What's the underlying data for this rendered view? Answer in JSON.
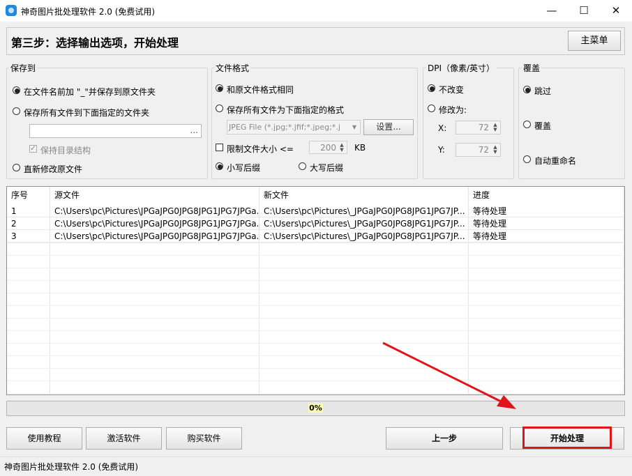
{
  "window": {
    "title": "神奇图片批处理软件 2.0 (免费试用)",
    "minimize_glyph": "—",
    "maximize_glyph": "☐",
    "close_glyph": "✕"
  },
  "header": {
    "step_title": "第三步：选择输出选项，开始处理",
    "main_menu_label": "主菜单"
  },
  "save_to": {
    "group_label": "保存到",
    "option_prefix": "在文件名前加 \"_\"并保存到原文件夹",
    "option_folder": "保存所有文件到下面指定的文件夹",
    "folder_value": "",
    "browse_label": "...",
    "keep_structure": "保持目录结构",
    "option_overwrite": "直新修改原文件"
  },
  "file_format": {
    "group_label": "文件格式",
    "same_format": "和原文件格式相同",
    "specified_format": "保存所有文件为下面指定的格式",
    "format_value": "JPEG File (*.jpg;*.jfif;*.jpeg;*.j",
    "settings_label": "设置...",
    "limit_size": "限制文件大小 <=",
    "size_value": "200",
    "size_unit": "KB",
    "lower_ext": "小写后缀",
    "upper_ext": "大写后缀"
  },
  "dpi": {
    "group_label": "DPI（像素/英寸）",
    "unchanged": "不改变",
    "modify": "修改为:",
    "x_label": "X:",
    "x_value": "72",
    "y_label": "Y:",
    "y_value": "72"
  },
  "overwrite": {
    "group_label": "覆盖",
    "skip": "跳过",
    "overwrite": "覆盖",
    "auto_rename": "自动重命名"
  },
  "table": {
    "headers": [
      "序号",
      "源文件",
      "新文件",
      "进度"
    ],
    "rows": [
      [
        "1",
        "C:\\Users\\pc\\Pictures\\JPGaJPG0JPG8JPG1JPG7JPGa...",
        "C:\\Users\\pc\\Pictures\\_JPGaJPG0JPG8JPG1JPG7JP...",
        "等待处理"
      ],
      [
        "2",
        "C:\\Users\\pc\\Pictures\\JPGaJPG0JPG8JPG1JPG7JPGa...",
        "C:\\Users\\pc\\Pictures\\_JPGaJPG0JPG8JPG1JPG7JP...",
        "等待处理"
      ],
      [
        "3",
        "C:\\Users\\pc\\Pictures\\JPGaJPG0JPG8JPG1JPG7JPGa...",
        "C:\\Users\\pc\\Pictures\\_JPGaJPG0JPG8JPG1JPG7JP...",
        "等待处理"
      ]
    ]
  },
  "progress": {
    "text": "0%",
    "fraction": 0
  },
  "buttons": {
    "tutorial": "使用教程",
    "activate": "激活软件",
    "buy": "购买软件",
    "prev": "上一步",
    "start": "开始处理"
  },
  "status_bar": {
    "text": "神奇图片批处理软件 2.0 (免费试用)"
  },
  "colors": {
    "annotation_red": "#e0141a",
    "progress_text_bg": "#ffffb0"
  }
}
